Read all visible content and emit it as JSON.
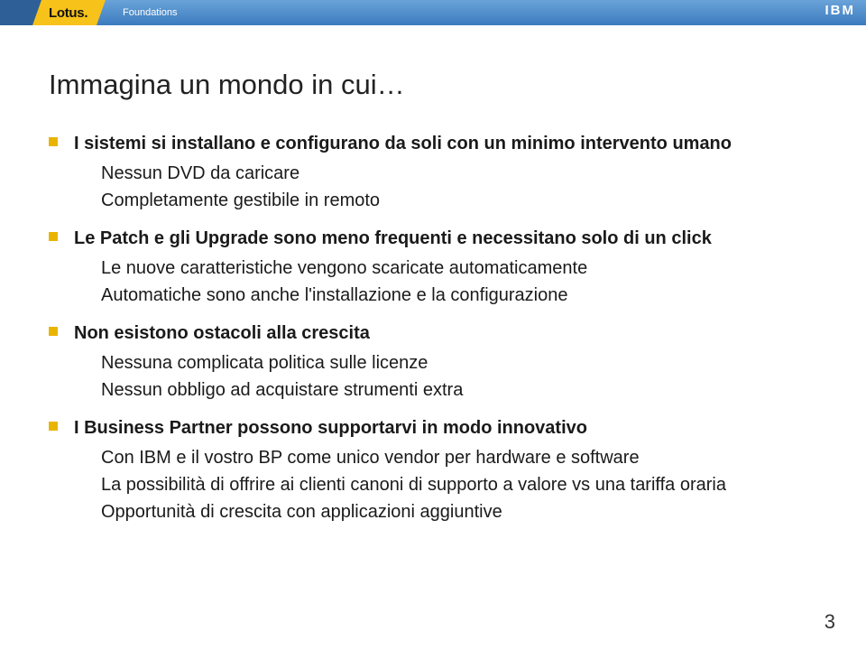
{
  "header": {
    "lotus": "Lotus.",
    "foundations": "Foundations",
    "ibm": "IBM"
  },
  "slide": {
    "title": "Immagina un mondo in cui…",
    "bullets": [
      {
        "main": "I sistemi si installano e configurano da soli con un minimo intervento umano",
        "subs": [
          "Nessun DVD da caricare",
          "Completamente gestibile in remoto"
        ]
      },
      {
        "main": "Le Patch e gli Upgrade sono meno frequenti e necessitano solo di un click",
        "subs": [
          "Le nuove caratteristiche vengono scaricate automaticamente",
          "Automatiche sono anche l'installazione e la configurazione"
        ]
      },
      {
        "main": "Non esistono ostacoli alla crescita",
        "subs": [
          "Nessuna complicata politica sulle licenze",
          "Nessun obbligo ad acquistare strumenti extra"
        ]
      },
      {
        "main": "I Business Partner possono supportarvi in modo innovativo",
        "subs": [
          "Con IBM e il vostro BP come unico vendor per hardware e software",
          "La possibilità di offrire ai clienti canoni di supporto a valore vs una tariffa oraria",
          "Opportunità di crescita con applicazioni aggiuntive"
        ]
      }
    ]
  },
  "page_number": "3"
}
